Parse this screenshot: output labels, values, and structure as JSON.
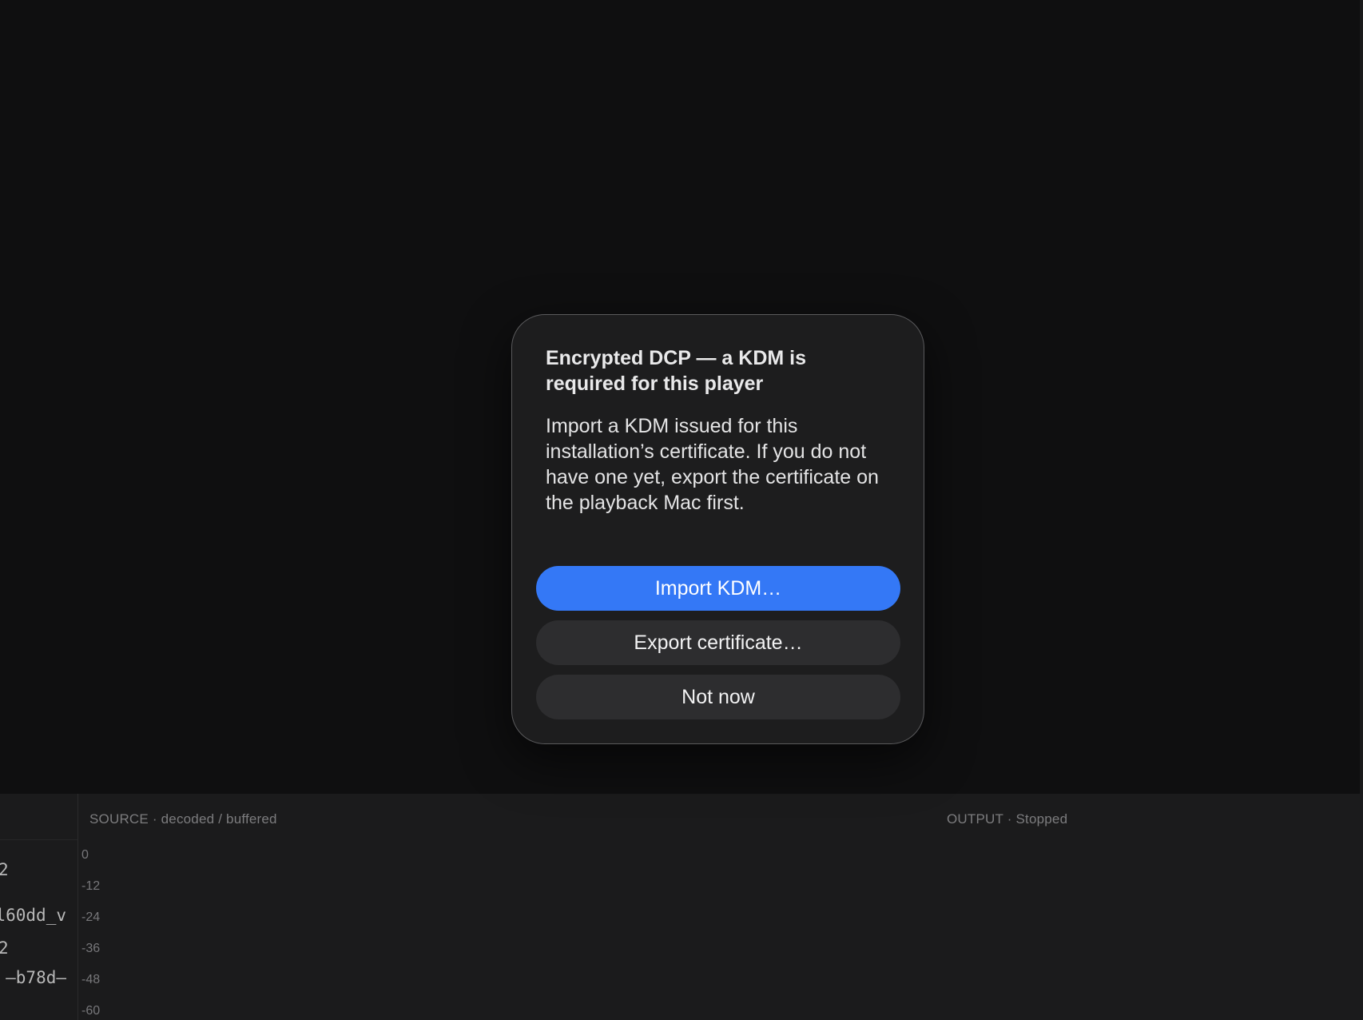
{
  "dialog": {
    "title": "Encrypted DCP — a KDM is required for this player",
    "message": "Import a KDM issued for this installation’s certificate. If you do not have one yet, export the certificate on the playback Mac first.",
    "buttons": {
      "import": "Import KDM…",
      "export": "Export certificate…",
      "not_now": "Not now"
    },
    "colors": {
      "primary": "#3478f6",
      "background": "#1d1d1e"
    }
  },
  "bottom_panel": {
    "source_label": "SOURCE · decoded / buffered",
    "output_label": "OUTPUT · Stopped",
    "meter_ticks": [
      "0",
      "-12",
      "-24",
      "-36",
      "-48",
      "-60"
    ],
    "left_fragments": {
      "f1": "2",
      "f2": "l60dd_v",
      "f3": "2",
      "f4": "—b78d—"
    }
  }
}
